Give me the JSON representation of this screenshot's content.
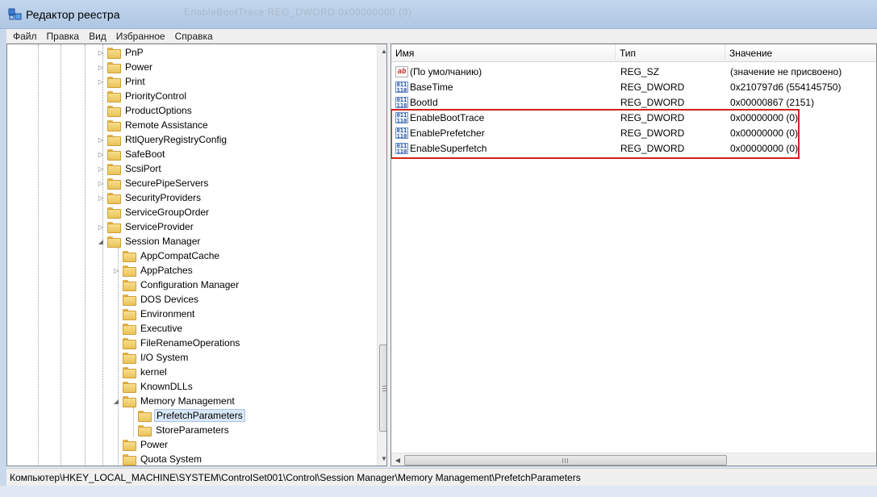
{
  "window": {
    "title": "Редактор реестра",
    "ghost_title": "EnableBootTrace  REG_DWORD  0x00000000 (0)"
  },
  "menu": [
    "Файл",
    "Правка",
    "Вид",
    "Избранное",
    "Справка"
  ],
  "tree": [
    {
      "label": "PnP",
      "expander": "closed"
    },
    {
      "label": "Power",
      "expander": "closed"
    },
    {
      "label": "Print",
      "expander": "closed"
    },
    {
      "label": "PriorityControl",
      "expander": "none"
    },
    {
      "label": "ProductOptions",
      "expander": "none"
    },
    {
      "label": "Remote Assistance",
      "expander": "none"
    },
    {
      "label": "RtlQueryRegistryConfig",
      "expander": "closed"
    },
    {
      "label": "SafeBoot",
      "expander": "closed"
    },
    {
      "label": "ScsiPort",
      "expander": "closed"
    },
    {
      "label": "SecurePipeServers",
      "expander": "closed"
    },
    {
      "label": "SecurityProviders",
      "expander": "closed"
    },
    {
      "label": "ServiceGroupOrder",
      "expander": "none"
    },
    {
      "label": "ServiceProvider",
      "expander": "closed"
    },
    {
      "label": "Session Manager",
      "expander": "open"
    },
    {
      "label": "AppCompatCache",
      "expander": "none"
    },
    {
      "label": "AppPatches",
      "expander": "closed"
    },
    {
      "label": "Configuration Manager",
      "expander": "none"
    },
    {
      "label": "DOS Devices",
      "expander": "none"
    },
    {
      "label": "Environment",
      "expander": "none"
    },
    {
      "label": "Executive",
      "expander": "none"
    },
    {
      "label": "FileRenameOperations",
      "expander": "none"
    },
    {
      "label": "I/O System",
      "expander": "none"
    },
    {
      "label": "kernel",
      "expander": "none"
    },
    {
      "label": "KnownDLLs",
      "expander": "none"
    },
    {
      "label": "Memory Management",
      "expander": "open"
    },
    {
      "label": "PrefetchParameters",
      "expander": "none",
      "selected": true
    },
    {
      "label": "StoreParameters",
      "expander": "none"
    },
    {
      "label": "Power",
      "expander": "none"
    },
    {
      "label": "Quota System",
      "expander": "none"
    }
  ],
  "list": {
    "columns": [
      "Имя",
      "Тип",
      "Значение"
    ],
    "rows": [
      {
        "name": "(По умолчанию)",
        "type": "REG_SZ",
        "value": "(значение не присвоено)",
        "icon": "ab"
      },
      {
        "name": "BaseTime",
        "type": "REG_DWORD",
        "value": "0x210797d6 (554145750)",
        "icon": "dword"
      },
      {
        "name": "BootId",
        "type": "REG_DWORD",
        "value": "0x00000867 (2151)",
        "icon": "dword"
      },
      {
        "name": "EnableBootTrace",
        "type": "REG_DWORD",
        "value": "0x00000000 (0)",
        "icon": "dword"
      },
      {
        "name": "EnablePrefetcher",
        "type": "REG_DWORD",
        "value": "0x00000000 (0)",
        "icon": "dword"
      },
      {
        "name": "EnableSuperfetch",
        "type": "REG_DWORD",
        "value": "0x00000000 (0)",
        "icon": "dword"
      }
    ]
  },
  "status": "Компьютер\\HKEY_LOCAL_MACHINE\\SYSTEM\\ControlSet001\\Control\\Session Manager\\Memory Management\\PrefetchParameters",
  "colors": {
    "highlight_border": "#d42020",
    "selection": "#d9e7f9"
  }
}
